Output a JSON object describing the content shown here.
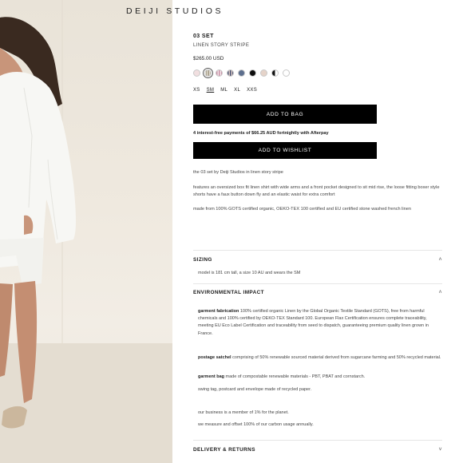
{
  "brand": {
    "logo": "DEIJI STUDIOS"
  },
  "product": {
    "title": "03 SET",
    "subtitle": "LINEN STORY STRIPE",
    "price": "$265.00 USD",
    "swatches": [
      {
        "name": "blush",
        "color": "#f1dfe0"
      },
      {
        "name": "linen-story-stripe",
        "color": "#e8e4d8",
        "selected": true
      },
      {
        "name": "pink-check",
        "color": "#c98fa5"
      },
      {
        "name": "navy-stripe",
        "color": "#4e5776"
      },
      {
        "name": "slate-blue",
        "color": "#5d6f8e"
      },
      {
        "name": "black",
        "color": "#0d0d0d"
      },
      {
        "name": "sand",
        "color": "#e5d3c9"
      },
      {
        "name": "black-white",
        "color": "#777777"
      },
      {
        "name": "white",
        "color": "#ffffff"
      }
    ],
    "sizes": [
      {
        "label": "XS"
      },
      {
        "label": "SM",
        "selected": true
      },
      {
        "label": "ML"
      },
      {
        "label": "XL"
      },
      {
        "label": "XXS"
      }
    ],
    "add_to_bag": "ADD TO BAG",
    "afterpay": "4 interest-free payments of $66.25 AUD fortnightly with Afterpay",
    "add_to_wishlist": "ADD TO WISHLIST",
    "description": [
      "the 03 set by Deiji Studios in linen story stripe",
      "features an oversized box fit linen shirt with wide arms and a front pocket designed to sit mid rise, the loose fitting boxer style shorts have a faux button down fly and an elastic waist for extra comfort",
      "made from 100% GOTS certified organic, OEKO-TEX 100 certified and EU certified stone washed french linen"
    ]
  },
  "accordions": {
    "sizing": {
      "title": "SIZING",
      "body": "model is 181 cm tall, a size 10 AU and wears the SM"
    },
    "environmental": {
      "title": "ENVIRONMENTAL IMPACT",
      "fabric_label": "garment fabrication",
      "fabric_text": " 100% certified organic Linen by the Global Organic Textile Standard (GOTS), free from harmful chemicals and 100% certified by OEKO-TEX Standard 100. European Flax Certification ensures complete traceability, meeting EU Eco Label Certification and traceability from seed to dispatch, guaranteeing premium quality linen grown in France.",
      "satchel_label": "postage satchel",
      "satchel_text": " comprising of 50% renewable sourced material derived from sugarcane farming and 50% recycled material.",
      "bag_label": "garment bag",
      "bag_text": " made of compostable renewable materials - PBT, PBAT and cornstarch.",
      "swing": "swing tag, postcard and envelope made of recycled paper.",
      "member": "our business is a member of 1% for the planet.",
      "carbon": "we measure and offset 100% of our carbon usage annually."
    },
    "delivery": {
      "title": "DELIVERY & RETURNS"
    }
  },
  "icons": {
    "chevron_up": "˄",
    "chevron_down": "˅"
  }
}
